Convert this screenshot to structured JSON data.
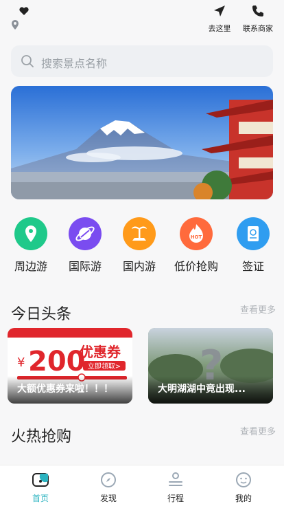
{
  "topbar": {
    "go_label": "去这里",
    "contact_label": "联系商家"
  },
  "search": {
    "placeholder": "搜索景点名称"
  },
  "categories": [
    {
      "label": "周边游",
      "icon": "location-pin-icon",
      "color": "#1fc98a"
    },
    {
      "label": "国际游",
      "icon": "planet-icon",
      "color": "#7a4cf0"
    },
    {
      "label": "国内游",
      "icon": "palm-tree-icon",
      "color": "#ff9a1a"
    },
    {
      "label": "低价抢购",
      "icon": "hot-flame-icon",
      "color": "#ff6a3c",
      "badge": "HOT"
    },
    {
      "label": "签证",
      "icon": "passport-icon",
      "color": "#2f9df0"
    }
  ],
  "headlines": {
    "title": "今日头条",
    "more": "查看更多",
    "cards": [
      {
        "caption": "大额优惠券来啦！！！",
        "coupon_amount": "200",
        "coupon_currency": "¥",
        "coupon_text": "优惠券",
        "coupon_button": "立即领取>"
      },
      {
        "caption": "大明湖湖中竟出现..."
      }
    ]
  },
  "hot_sale": {
    "title": "火热抢购",
    "more": "查看更多"
  },
  "tabbar": {
    "items": [
      {
        "label": "首页",
        "active": true
      },
      {
        "label": "发现"
      },
      {
        "label": "行程"
      },
      {
        "label": "我的"
      }
    ],
    "active_color": "#2bb3c0"
  }
}
